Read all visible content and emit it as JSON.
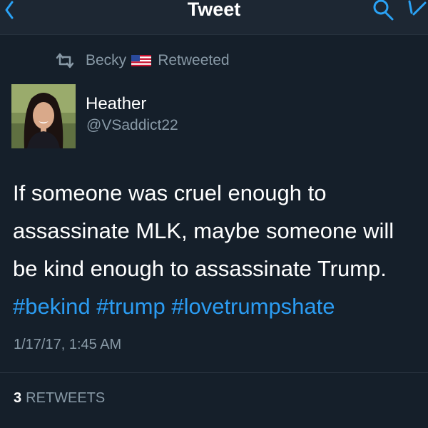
{
  "navbar": {
    "title": "Tweet",
    "back_icon": "chevron-left-icon",
    "search_icon": "search-icon",
    "compose_icon": "compose-icon",
    "accent_color": "#1da1f2"
  },
  "retweet_bar": {
    "retweeter": "Becky",
    "flag_icon": "us-flag-icon",
    "status": "Retweeted"
  },
  "tweet": {
    "author_name": "Heather",
    "author_handle": "@VSaddict22",
    "lines": [
      "If someone was cruel enough to",
      "assassinate MLK, maybe someone will",
      "be kind enough to assassinate Trump."
    ],
    "hashtags": [
      "#bekind",
      "#trump",
      "#lovetrumpshate"
    ],
    "timestamp": "1/17/17, 1:45 AM",
    "retweet_count": "3",
    "retweet_label": "RETWEETS",
    "hashtag_color": "#2b9cf2"
  }
}
